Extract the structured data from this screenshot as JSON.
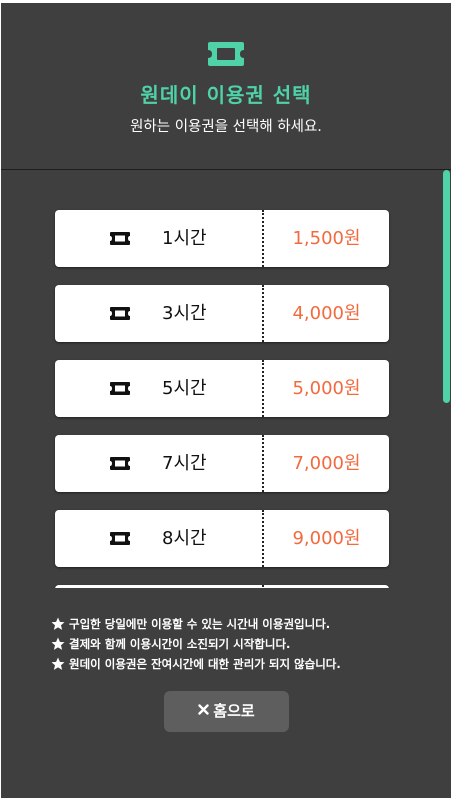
{
  "header": {
    "icon": "ticket-icon",
    "title": "원데이 이용권 선택",
    "subtitle": "원하는 이용권을 선택해 하세요."
  },
  "tickets": [
    {
      "label": "1시간",
      "price": "1,500원",
      "icon": "ticket-icon"
    },
    {
      "label": "3시간",
      "price": "4,000원",
      "icon": "ticket-icon"
    },
    {
      "label": "5시간",
      "price": "5,000원",
      "icon": "ticket-icon"
    },
    {
      "label": "7시간",
      "price": "7,000원",
      "icon": "ticket-icon"
    },
    {
      "label": "8시간",
      "price": "9,000원",
      "icon": "ticket-icon"
    }
  ],
  "notes": [
    "구입한 당일에만 이용할 수 있는 시간내 이용권입니다.",
    "결제와 함께 이용시간이 소진되기 시작합니다.",
    "원데이 이용권은 잔여시간에 대한 관리가 되지 않습니다."
  ],
  "home_button": {
    "label": "홈으로",
    "icon": "close-icon"
  },
  "colors": {
    "accent": "#4fd2a8",
    "price": "#f26a3d",
    "background": "#3f3f3f",
    "button": "#5e5e5e"
  }
}
